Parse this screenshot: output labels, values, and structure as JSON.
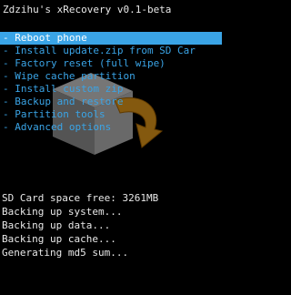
{
  "title": "Zdzihu's xRecovery v0.1-beta",
  "menu": {
    "items": [
      {
        "label": "- Reboot phone",
        "selected": true
      },
      {
        "label": "- Install update.zip from SD Car",
        "selected": false
      },
      {
        "label": "- Factory reset (full wipe)",
        "selected": false
      },
      {
        "label": "- Wipe cache partition",
        "selected": false
      },
      {
        "label": "- Install custom zip",
        "selected": false
      },
      {
        "label": "- Backup and restore",
        "selected": false
      },
      {
        "label": "- Partition tools",
        "selected": false
      },
      {
        "label": "- Advanced options",
        "selected": false
      }
    ]
  },
  "log": {
    "lines": [
      "SD Card space free: 3261MB",
      "Backing up system...",
      "Backing up data...",
      "Backing up cache...",
      "Generating md5 sum..."
    ]
  },
  "colors": {
    "accent": "#3aa4e6",
    "text": "#e8e8e8",
    "background": "#000000"
  },
  "icons": {
    "logo": "recovery-box-arrow-icon"
  }
}
